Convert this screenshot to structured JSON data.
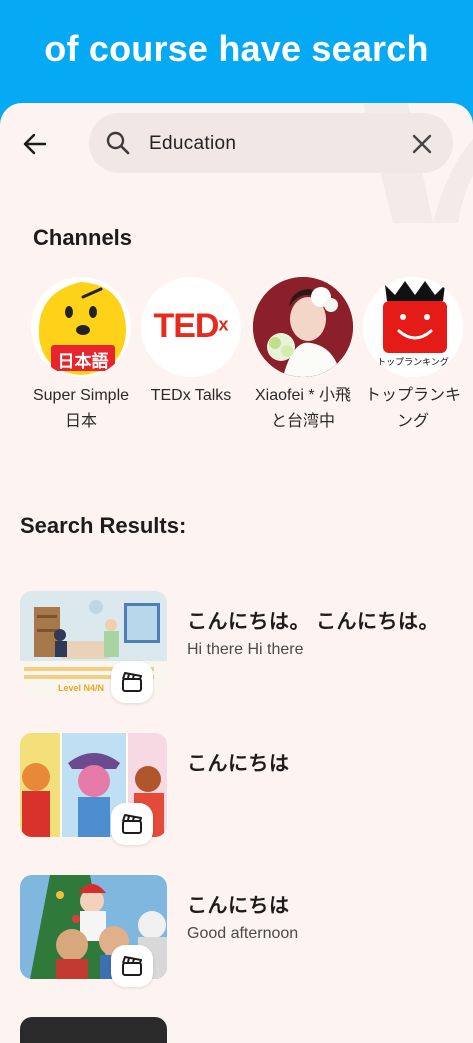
{
  "banner": {
    "text": "of course have search"
  },
  "search": {
    "value": "Education"
  },
  "channels": {
    "title": "Channels",
    "items": [
      {
        "name": "Super Simple 日本",
        "avatar_text": "日本語",
        "avatar_bg": "#ffd21a"
      },
      {
        "name": "TEDx Talks",
        "logo_text": "TED",
        "logo_sup": "x",
        "logo_color": "#e62b1e"
      },
      {
        "name": "Xiaofei * 小飛と台湾中"
      },
      {
        "name": "トップランキング",
        "avatar_text": "トップランキング",
        "logo_color": "#e41b17"
      }
    ]
  },
  "results": {
    "title": "Search Results:",
    "items": [
      {
        "title": "こんにちは。 こんにちは。",
        "subtitle": "Hi there Hi there",
        "thumb_caption": "Level N4/N"
      },
      {
        "title": "こんにちは",
        "subtitle": ""
      },
      {
        "title": "こんにちは",
        "subtitle": "Good afternoon"
      }
    ]
  },
  "colors": {
    "banner": "#06a9f4",
    "sheet": "#fdf4f1",
    "search_bg": "#f1e7e4",
    "ted_red": "#e62b1e"
  },
  "icons": {
    "back": "arrow-left-icon",
    "search": "search-icon",
    "clear": "close-icon",
    "badge": "clapperboard-icon"
  }
}
